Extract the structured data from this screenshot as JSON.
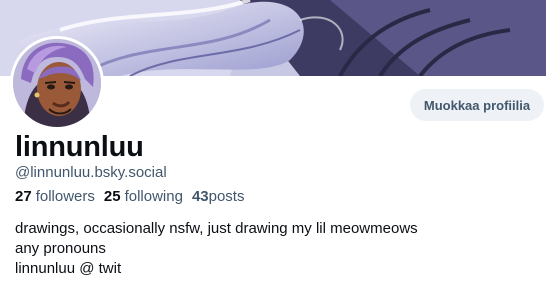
{
  "profile": {
    "display_name": "linnunluu",
    "handle": "@linnunluu.bsky.social",
    "edit_button_label": "Muokkaa profiilia",
    "stats": {
      "followers_count": "27",
      "followers_label": "followers",
      "following_count": "25",
      "following_label": "following",
      "posts_count": "43",
      "posts_label": "posts"
    },
    "bio_lines": [
      "drawings, occasionally nsfw, just drawing my lil meowmeows",
      "any pronouns",
      "linnunluu @ twit"
    ]
  },
  "colors": {
    "text_primary": "#0b0f14",
    "text_secondary": "#42576c",
    "button_background": "#eef2f6"
  }
}
